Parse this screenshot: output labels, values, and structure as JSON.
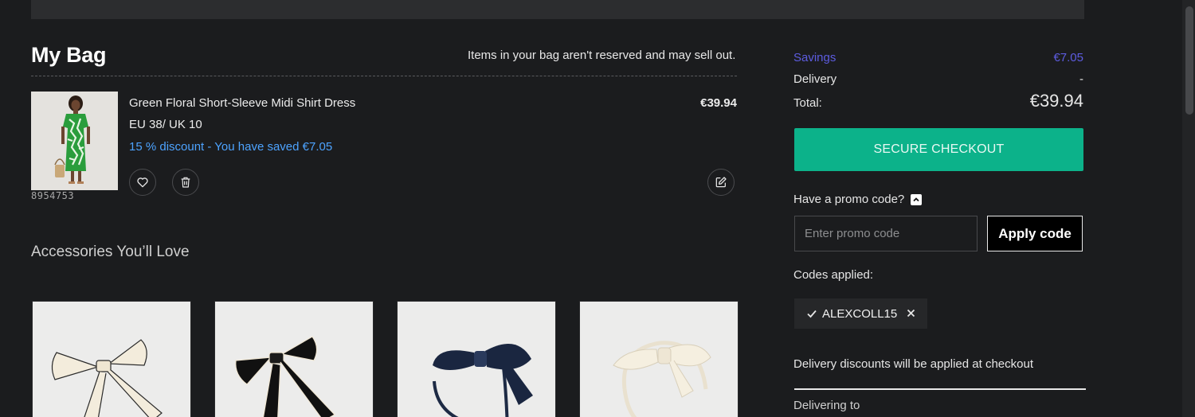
{
  "bag": {
    "title": "My Bag",
    "notice": "Items in your bag aren't reserved and may sell out."
  },
  "item": {
    "name": "Green Floral Short-Sleeve Midi Shirt Dress",
    "size": "EU 38/ UK 10",
    "discount_text": "15 % discount - You have saved €7.05",
    "price": "€39.94",
    "sku": "8954753"
  },
  "accessories": {
    "heading": "Accessories You’ll Love"
  },
  "summary": {
    "savings_label": "Savings",
    "savings_value": "€7.05",
    "delivery_label": "Delivery",
    "delivery_value": "-",
    "total_label": "Total:",
    "total_value": "€39.94",
    "checkout_label": "SECURE CHECKOUT",
    "promo_toggle": "Have a promo code?",
    "promo_placeholder": "Enter promo code",
    "apply_label": "Apply code",
    "codes_applied_label": "Codes applied:",
    "applied_code": "ALEXCOLL15",
    "delivery_note": "Delivery discounts will be applied at checkout",
    "delivering_to": "Delivering to"
  },
  "colors": {
    "background": "#1b1c1e",
    "checkout_green": "#0cb28a",
    "savings_purple": "#5d5ce0",
    "discount_blue": "#4da3ff"
  },
  "icons": {
    "wishlist": "heart-icon",
    "delete": "trash-icon",
    "edit": "edit-icon",
    "promo_toggle": "chevron-up-icon",
    "code_applied": "check-icon",
    "remove_code": "close-icon"
  }
}
